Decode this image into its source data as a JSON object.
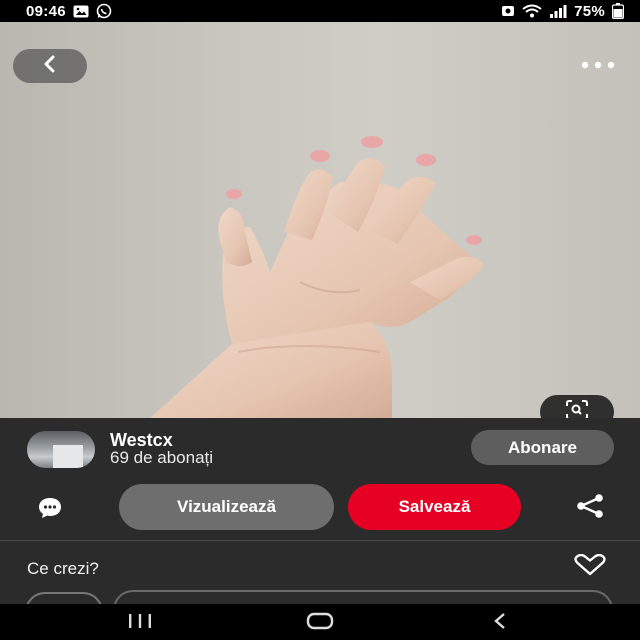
{
  "status_bar": {
    "time": "09:46",
    "battery": "75%",
    "left_icons": [
      "gallery-icon",
      "whatsapp-icon"
    ],
    "right_icons": [
      "sim-icon",
      "wifi-icon",
      "signal-icon",
      "battery-icon"
    ]
  },
  "top_controls": {
    "back_icon": "chevron-left-icon",
    "more_icon": "more-horizontal-icon",
    "visual_search_icon": "visual-search-icon"
  },
  "creator": {
    "name": "Westcx",
    "followers": "69 de abonați",
    "follow_label": "Abonare"
  },
  "actions": {
    "comment_icon": "speech-bubble-icon",
    "visit_label": "Vizualizează",
    "save_label": "Salvează",
    "share_icon": "share-icon"
  },
  "comments": {
    "prompt": "Ce crezi?",
    "like_icon": "heart-icon"
  },
  "nav_bar": {
    "icons": [
      "recent-apps-icon",
      "home-icon",
      "back-icon"
    ]
  },
  "colors": {
    "save_red": "#e60023",
    "sheet_bg": "#2b2b2b",
    "visit_gray": "#6e6e6e",
    "follow_gray": "#5e5e5e"
  }
}
